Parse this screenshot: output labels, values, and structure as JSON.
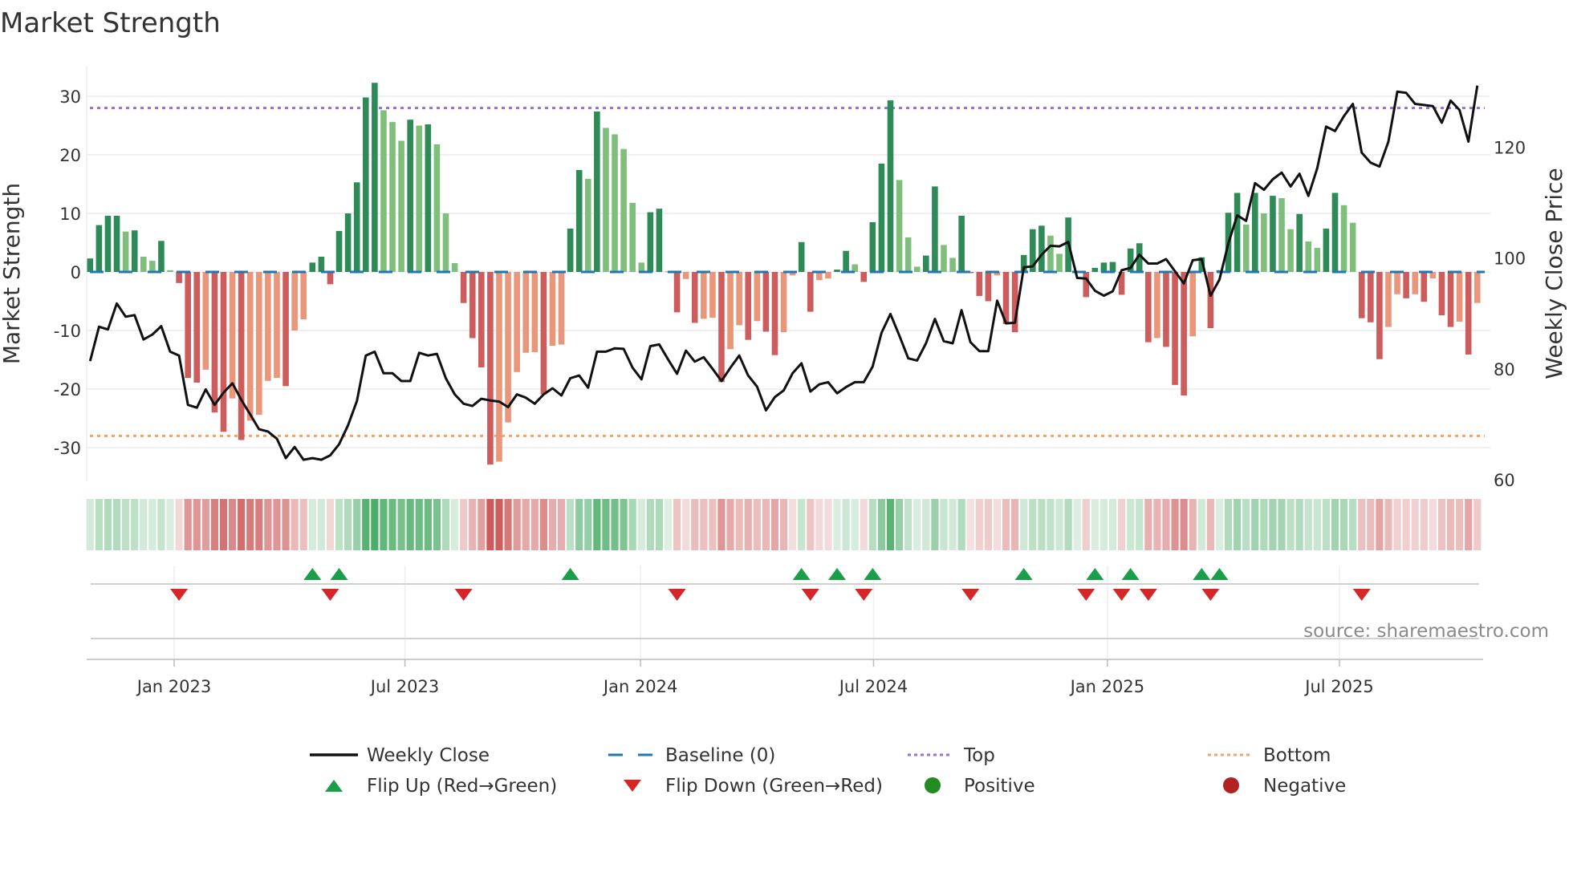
{
  "chart_data": {
    "type": "bar",
    "title": "Market Strength",
    "ylabel": "Market Strength",
    "y2label": "Weekly Close Price",
    "xlabel": "",
    "ylim": [
      -35.8,
      35.3
    ],
    "y2lim": [
      59.7,
      134.7
    ],
    "yticks": [
      30,
      20,
      10,
      0,
      -10,
      -20,
      -30
    ],
    "y2ticks": [
      120,
      100,
      80,
      60
    ],
    "x_ticks": [
      {
        "label": "Jan 2023",
        "week_index": 9.45
      },
      {
        "label": "Jul 2023",
        "week_index": 35.4
      },
      {
        "label": "Jan 2024",
        "week_index": 61.9
      },
      {
        "label": "Jul 2024",
        "week_index": 88.1
      },
      {
        "label": "Jan 2025",
        "week_index": 114.4
      },
      {
        "label": "Jul 2025",
        "week_index": 140.5
      }
    ],
    "grid": true,
    "levels": {
      "top": 28,
      "bottom": -28,
      "baseline": 0
    },
    "series": [
      {
        "name": "Market Strength",
        "kind": "bar",
        "values": [
          2.3,
          8.0,
          9.6,
          9.6,
          6.9,
          7.1,
          2.6,
          1.9,
          5.3,
          0.3,
          -1.9,
          -18.1,
          -18.9,
          -16.7,
          -24.0,
          -27.3,
          -21.6,
          -28.7,
          -25.4,
          -24.4,
          -18.6,
          -18.1,
          -19.5,
          -10.0,
          -8.1,
          1.6,
          2.6,
          -2.1,
          7.0,
          10.0,
          15.3,
          29.8,
          32.3,
          27.6,
          25.6,
          22.4,
          26.0,
          25.0,
          25.2,
          21.8,
          10.0,
          1.5,
          -5.3,
          -11.3,
          -16.3,
          -32.9,
          -32.4,
          -25.7,
          -17.1,
          -13.8,
          -13.7,
          -20.9,
          -12.6,
          -12.4,
          7.4,
          17.4,
          15.9,
          27.4,
          24.6,
          23.5,
          21.0,
          11.8,
          1.6,
          10.2,
          10.8,
          0.1,
          -6.9,
          -1.2,
          -8.7,
          -8.0,
          -7.8,
          -18.8,
          -13.2,
          -9.1,
          -11.6,
          -8.4,
          -10.2,
          -14.2,
          -10.3,
          -0.6,
          5.1,
          -6.8,
          -1.4,
          -1.1,
          0.4,
          3.6,
          1.3,
          -1.7,
          8.5,
          18.5,
          29.3,
          15.7,
          5.9,
          0.9,
          2.8,
          14.6,
          4.6,
          2.4,
          9.6,
          -0.2,
          -4.1,
          -5.0,
          -0.6,
          -8.9,
          -10.3,
          2.9,
          7.3,
          7.9,
          6.2,
          3.1,
          9.3,
          0.2,
          -4.3,
          0.7,
          1.6,
          1.7,
          -3.9,
          4.0,
          4.9,
          -12.0,
          -11.3,
          -12.8,
          -19.3,
          -21.1,
          -11.0,
          2.5,
          -9.6,
          0.3,
          10.1,
          13.5,
          8.1,
          13.5,
          10.0,
          13.0,
          12.6,
          7.3,
          9.9,
          5.2,
          4.1,
          7.4,
          13.5,
          11.4,
          8.4,
          -7.9,
          -8.6,
          -14.9,
          -9.4,
          -3.8,
          -4.5,
          -3.8,
          -5.1,
          -1.1,
          -7.4,
          -9.4,
          -8.5,
          -14.1,
          -5.3
        ]
      },
      {
        "name": "Weekly Close",
        "kind": "line",
        "axis": "right",
        "values": [
          81.4,
          87.6,
          87.1,
          91.8,
          89.4,
          89.7,
          85.3,
          86.2,
          87.7,
          83.1,
          82.4,
          73.5,
          73.0,
          76.3,
          73.5,
          75.7,
          77.4,
          74.4,
          71.8,
          69.1,
          68.7,
          67.4,
          63.9,
          65.9,
          63.6,
          63.9,
          63.6,
          64.4,
          66.4,
          69.8,
          74.2,
          82.4,
          83.1,
          79.2,
          79.2,
          77.8,
          77.8,
          82.9,
          82.4,
          82.7,
          78.3,
          75.4,
          73.7,
          73.3,
          74.6,
          74.3,
          74.1,
          73.1,
          75.4,
          74.8,
          73.7,
          75.4,
          76.5,
          75.2,
          78.3,
          78.8,
          76.6,
          83.1,
          83.1,
          83.7,
          83.6,
          80.2,
          78.1,
          84.1,
          84.4,
          81.7,
          79.1,
          83.3,
          81.3,
          82.1,
          80.0,
          77.8,
          80.2,
          82.4,
          78.8,
          76.8,
          72.5,
          74.9,
          76.1,
          79.2,
          81.0,
          75.9,
          77.2,
          77.6,
          75.6,
          76.7,
          77.6,
          77.6,
          80.4,
          86.5,
          89.9,
          86.0,
          81.9,
          81.5,
          84.6,
          89.0,
          85.0,
          84.6,
          90.6,
          84.8,
          83.2,
          83.2,
          92.3,
          88.2,
          88.3,
          98.3,
          98.5,
          100.6,
          102.2,
          102.1,
          102.9,
          96.4,
          96.3,
          94.1,
          93.2,
          94.0,
          97.8,
          98.2,
          100.6,
          99.0,
          99.0,
          99.8,
          97.6,
          95.4,
          99.6,
          99.8,
          93.2,
          96.1,
          102.6,
          107.7,
          106.7,
          113.5,
          112.3,
          114.2,
          115.4,
          112.9,
          115.2,
          111.2,
          116.2,
          123.7,
          122.9,
          125.6,
          127.8,
          119.0,
          117.2,
          116.5,
          121.0,
          130.0,
          129.8,
          127.8,
          127.6,
          127.4,
          124.4,
          128.4,
          126.7,
          121.0,
          131.1
        ]
      }
    ],
    "flip_up_week_indices": [
      25,
      28,
      54,
      80,
      84,
      88,
      105,
      113,
      117,
      125,
      127
    ],
    "flip_down_week_indices": [
      10,
      27,
      42,
      66,
      81,
      87,
      99,
      112,
      116,
      119,
      126,
      143
    ],
    "legend": {
      "placement": "bottom",
      "items": [
        {
          "label": "Weekly Close"
        },
        {
          "label": "Baseline (0)"
        },
        {
          "label": "Top"
        },
        {
          "label": "Bottom"
        },
        {
          "label": "Flip Up (Red→Green)"
        },
        {
          "label": "Flip Down (Green→Red)"
        },
        {
          "label": "Positive"
        },
        {
          "label": "Negative"
        }
      ]
    },
    "annotation": "source: sharemaestro.com",
    "colors": {
      "pos_strong": "#2e8b57",
      "pos_weak": "#7fbf7b",
      "neg_strong": "#cd5c5c",
      "neg_weak": "#e9967a",
      "line": "#111111",
      "baseline": "#1f77b4",
      "top": "#9370db",
      "bottom": "#f4a460",
      "flip_up": "#1a9e4a",
      "flip_down": "#d62728",
      "positive_dot": "#228b22",
      "negative_dot": "#b22222",
      "grid": "#eef0f3"
    }
  }
}
